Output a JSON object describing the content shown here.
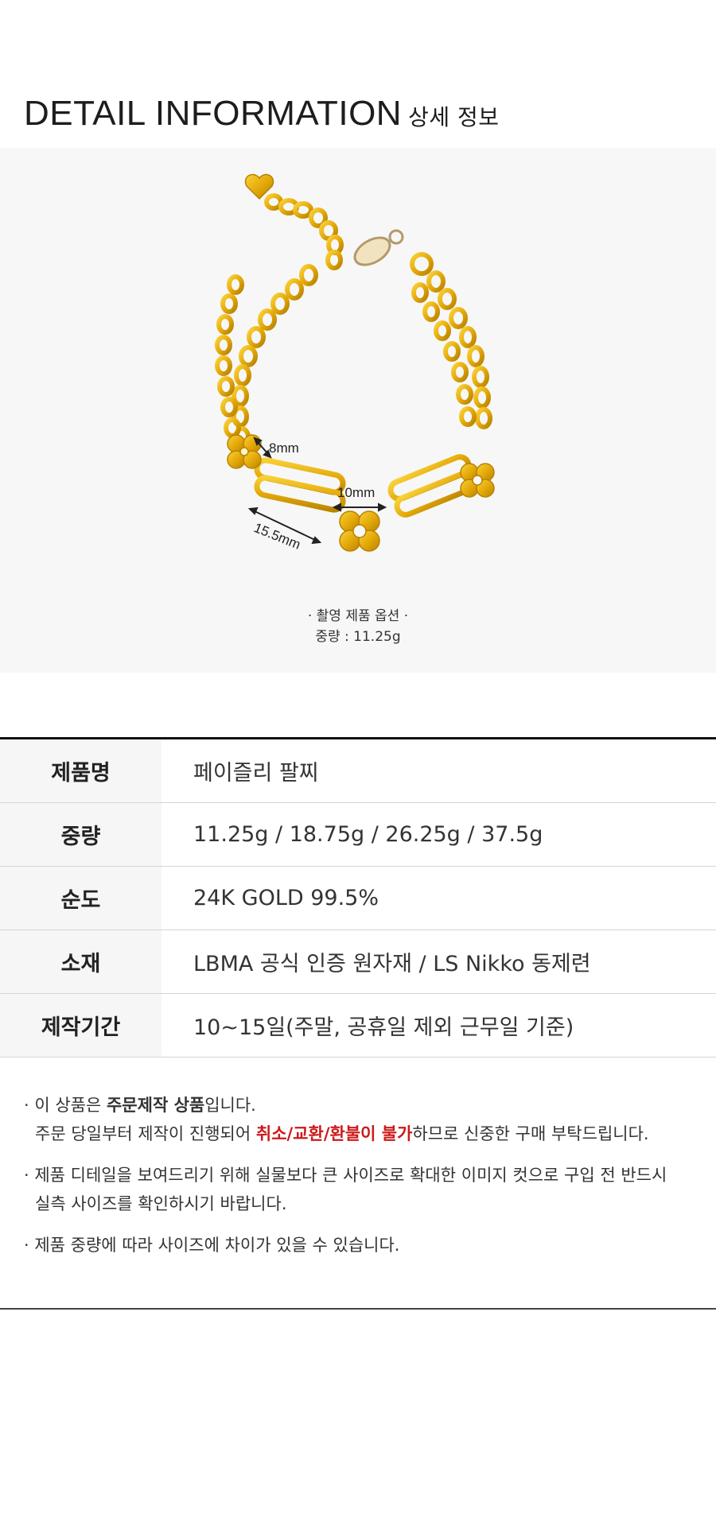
{
  "header": {
    "title_en": "DETAIL INFORMATION",
    "title_ko": "상세 정보"
  },
  "photo": {
    "dims": {
      "link_width": "8mm",
      "clover_size": "10mm",
      "bar_length": "15.5mm"
    },
    "caption1": "· 촬영 제품 옵션 ·",
    "caption2": "중량 : 11.25g"
  },
  "spec": [
    {
      "label": "제품명",
      "value": "페이즐리 팔찌"
    },
    {
      "label": "중량",
      "value": "11.25g / 18.75g / 26.25g / 37.5g"
    },
    {
      "label": "순도",
      "value": "24K GOLD 99.5%"
    },
    {
      "label": "소재",
      "value": "LBMA 공식 인증 원자재 / LS Nikko 동제련"
    },
    {
      "label": "제작기간",
      "value": "10~15일(주말, 공휴일 제외 근무일 기준)"
    }
  ],
  "notes": {
    "n1": {
      "prefix": "· 이 상품은 ",
      "bold": "주문제작 상품",
      "suffix": "입니다.",
      "l2_pre": "주문 당일부터 제작이 진행되어 ",
      "l2_red": "취소/교환/환불이 불가",
      "l2_post": "하므로 신중한 구매 부탁드립니다."
    },
    "n2": {
      "l1": "· 제품 디테일을 보여드리기 위해 실물보다 큰 사이즈로 확대한 이미지 컷으로 구입 전 반드시",
      "l2": "실측 사이즈를 확인하시기 바랍니다."
    },
    "n3": {
      "l1": "·  제품 중량에 따라 사이즈에 차이가 있을 수 있습니다."
    }
  },
  "colors": {
    "gold": "#e8b512",
    "gold_dark": "#c98f00",
    "accent_red": "#cc1a1a"
  }
}
